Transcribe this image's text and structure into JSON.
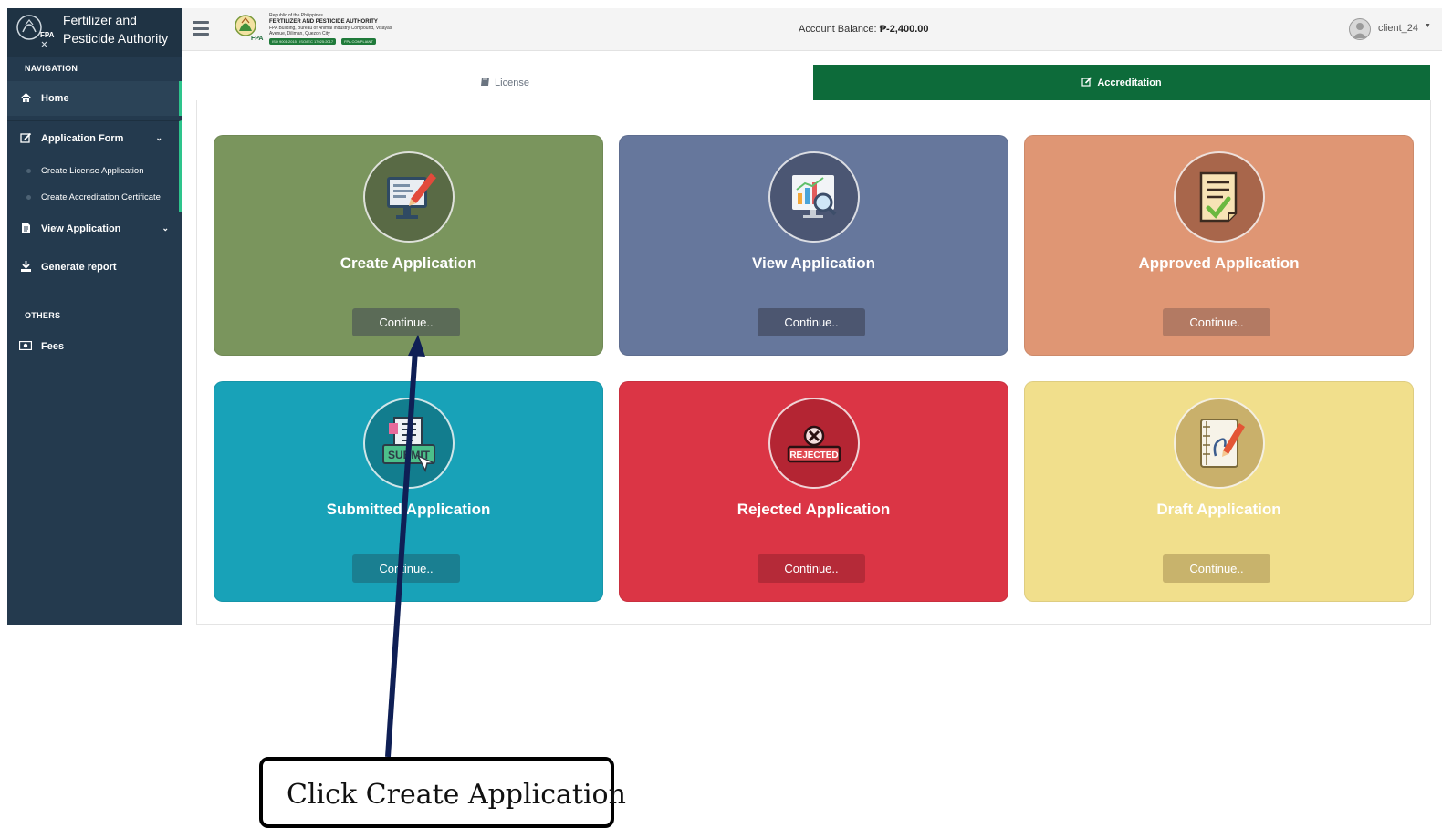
{
  "sidebar": {
    "brand_line1": "Fertilizer and",
    "brand_line2": "Pesticide Authority",
    "nav_heading": "NAVIGATION",
    "items": [
      {
        "label": "Home",
        "icon": "home-icon"
      },
      {
        "label": "Application Form",
        "icon": "edit-icon"
      },
      {
        "label": "View Application",
        "icon": "file-icon"
      },
      {
        "label": "Generate report",
        "icon": "download-icon"
      }
    ],
    "sub_items": [
      {
        "label": "Create License Application"
      },
      {
        "label": "Create Accreditation Certificate"
      }
    ],
    "others_heading": "OTHERS",
    "others_items": [
      {
        "label": "Fees",
        "icon": "money-icon"
      }
    ]
  },
  "header": {
    "logo_small_line": "Republic of the Philippines",
    "logo_title": "FERTILIZER AND PESTICIDE AUTHORITY",
    "logo_address1": "FPA Building, Bureau of Animal Industry Compound, Visayas",
    "logo_address2": "Avenue, Diliman, Quezon City",
    "badge1": "ISO 9001:2015 | ISO/IEC 17025:2017",
    "badge2": "FPA COMPLIANT",
    "balance_label": "Account Balance:",
    "balance_value": "₱-2,400.00",
    "username": "client_24"
  },
  "tabs": [
    {
      "label": "License",
      "icon": "book-icon",
      "active": false
    },
    {
      "label": "Accreditation",
      "icon": "edit-icon",
      "active": true
    }
  ],
  "cards": [
    {
      "title": "Create Application",
      "button": "Continue..",
      "color": "#7a955d",
      "button_color": "#5b6b57",
      "icon": "monitor-pen-icon"
    },
    {
      "title": "View Application",
      "button": "Continue..",
      "color": "#66779c",
      "button_color": "#4c5670",
      "icon": "chart-magnifier-icon"
    },
    {
      "title": "Approved Application",
      "button": "Continue..",
      "color": "#df9674",
      "button_color": "#b37a63",
      "icon": "approved-document-icon"
    },
    {
      "title": "Submitted Application",
      "button": "Continue..",
      "color": "#18a2b8",
      "button_color": "#1a7f91",
      "icon": "submit-icon"
    },
    {
      "title": "Rejected Application",
      "button": "Continue..",
      "color": "#db3545",
      "button_color": "#b52a38",
      "icon": "rejected-icon"
    },
    {
      "title": "Draft Application",
      "button": "Continue..",
      "color": "#f1df8c",
      "button_color": "#c8b36c",
      "icon": "draft-note-icon"
    }
  ],
  "annotation": {
    "text": "Click Create Application"
  },
  "colors": {
    "sidebar": "#243a4e",
    "accent_green": "#0d6b3a",
    "active_marker": "#2ec48c"
  }
}
